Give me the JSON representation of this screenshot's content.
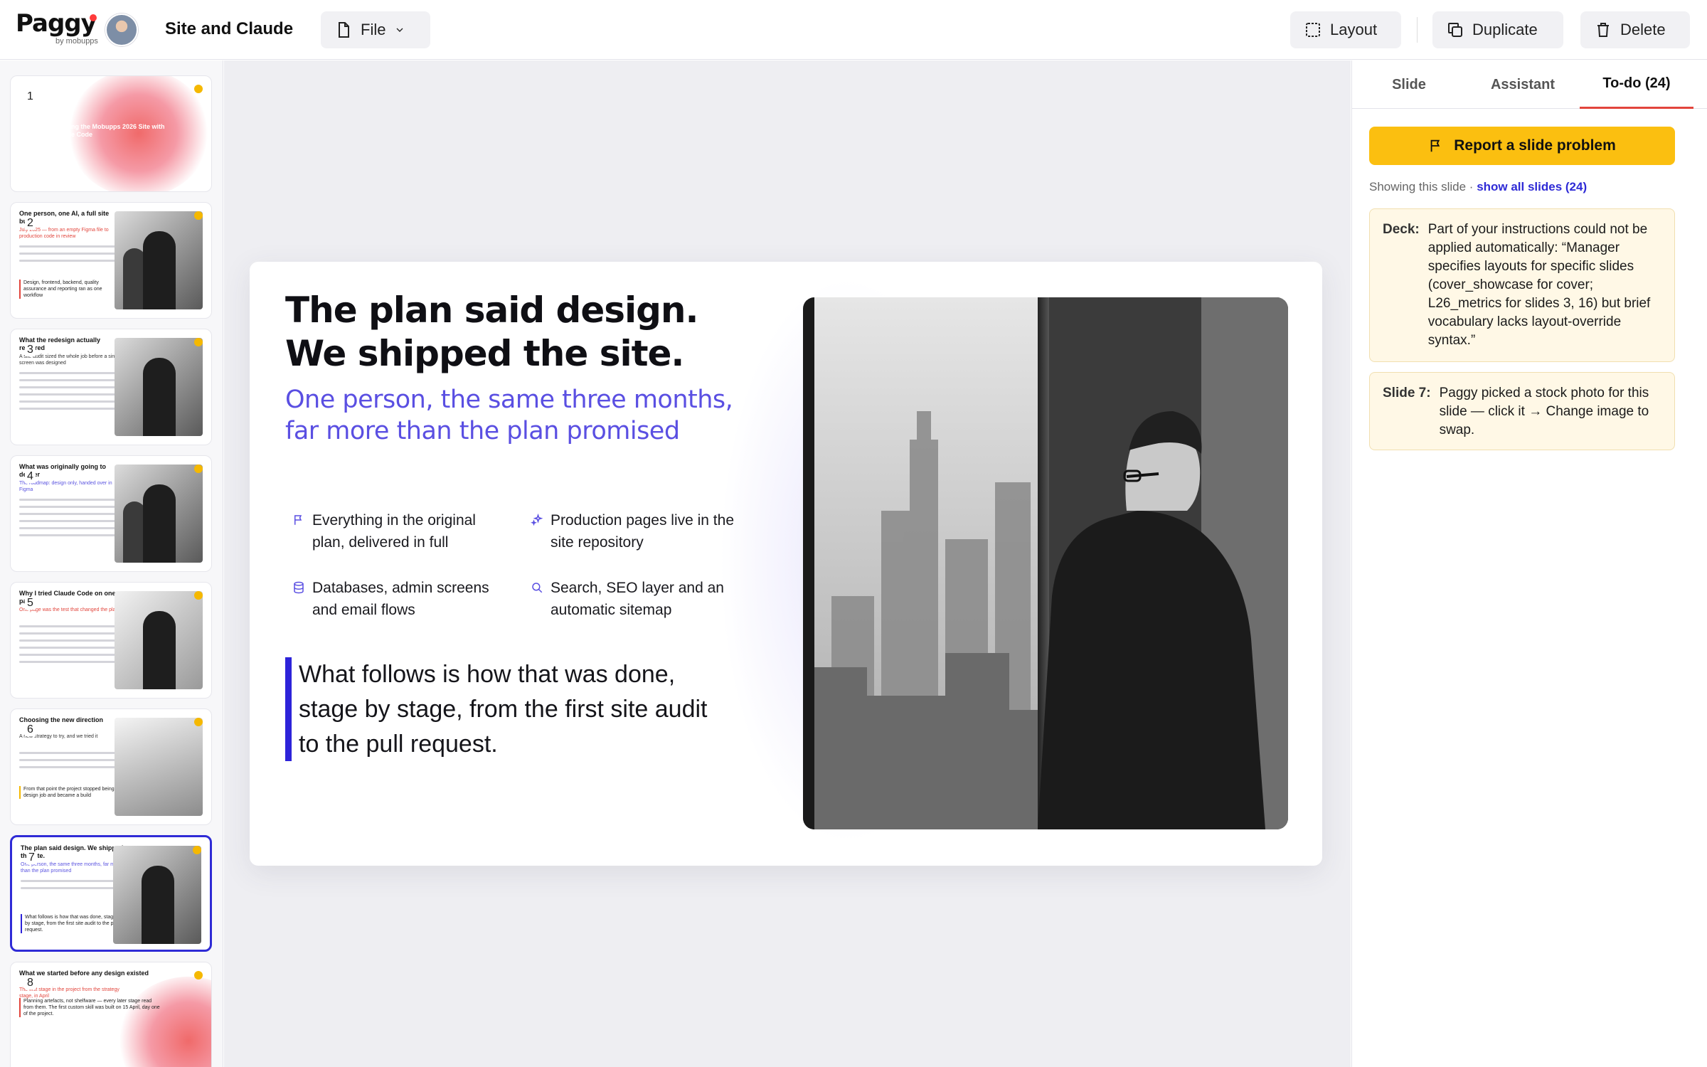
{
  "header": {
    "logo": "Paggy",
    "logo_sub": "by mobupps",
    "doc_title": "Site and Claude",
    "file_label": "File",
    "layout_label": "Layout",
    "duplicate_label": "Duplicate",
    "delete_label": "Delete"
  },
  "thumbnails": [
    {
      "num": "1",
      "title": "Building the Mobupps 2026 Site with Claude Code",
      "subtitle": "",
      "has_dot": true
    },
    {
      "num": "2",
      "title": "One person, one AI, a full site build",
      "subtitle": "July 2025 — from an empty Figma file to production code in review",
      "quote": "Design, frontend, backend, quality assurance and reporting ran as one workflow",
      "has_dot": true
    },
    {
      "num": "3",
      "title": "What the redesign actually required",
      "subtitle": "A site audit sized the whole job before a single screen was designed",
      "has_dot": true
    },
    {
      "num": "4",
      "title": "What was originally going to deliver",
      "subtitle": "The roadmap: design only, handed over in Figma",
      "has_dot": true
    },
    {
      "num": "5",
      "title": "Why I tried Claude Code on one page",
      "subtitle": "One page was the test that changed the plan",
      "has_dot": true
    },
    {
      "num": "6",
      "title": "Choosing the new direction",
      "subtitle": "A new strategy to try, and we tried it",
      "quote": "From that point the project stopped being a design job and became a build",
      "has_dot": true
    },
    {
      "num": "7",
      "title": "The plan said design. We shipped the site.",
      "subtitle": "One person, the same three months, far more than the plan promised",
      "quote": "What follows is how that was done, stage by stage, from the first site audit to the pull request.",
      "has_dot": true,
      "active": true
    },
    {
      "num": "8",
      "title": "What we started before any design existed",
      "subtitle": "The first stage in the project from the strategy stage, in April",
      "quote": "Planning artefacts, not shelfware — every later stage read from them. The first custom skill was built on 15 April, day one of the project.",
      "has_dot": true
    }
  ],
  "slide": {
    "title": "The plan said design. We shipped the site.",
    "subtitle": "One person, the same three months, far more than the plan promised",
    "bullets": [
      {
        "icon": "flag-icon",
        "text": "Everything in the original plan, delivered in full"
      },
      {
        "icon": "sparkle-icon",
        "text": "Production pages live in the site repository"
      },
      {
        "icon": "database-icon",
        "text": "Databases, admin screens and email flows"
      },
      {
        "icon": "search-icon",
        "text": "Search, SEO layer and an automatic sitemap"
      }
    ],
    "quote": "What follows is how that was done, stage by stage, from the first site audit to the pull request."
  },
  "panel": {
    "tabs": [
      "Slide",
      "Assistant",
      "To-do (24)"
    ],
    "active_tab": "To-do (24)",
    "report_label": "Report a slide problem",
    "showing_prefix": "Showing this slide · ",
    "showing_link": "show all slides (24)",
    "cards": [
      {
        "label": "Deck:",
        "text": "Part of your instructions could not be applied automatically: “Manager specifies layouts for specific slides (cover_showcase for cover; L26_metrics for slides 3, 16) but brief vocabulary lacks layout-override syntax.”"
      },
      {
        "label": "Slide 7:",
        "text": "Paggy picked a stock photo for this slide — click it → Change image to swap."
      }
    ]
  },
  "colors": {
    "accent": "#2f2bd6",
    "subtitle": "#5a4fe2",
    "report": "#fbbf10",
    "todo_underline": "#e2453c",
    "status_dot": "#f5b800"
  }
}
